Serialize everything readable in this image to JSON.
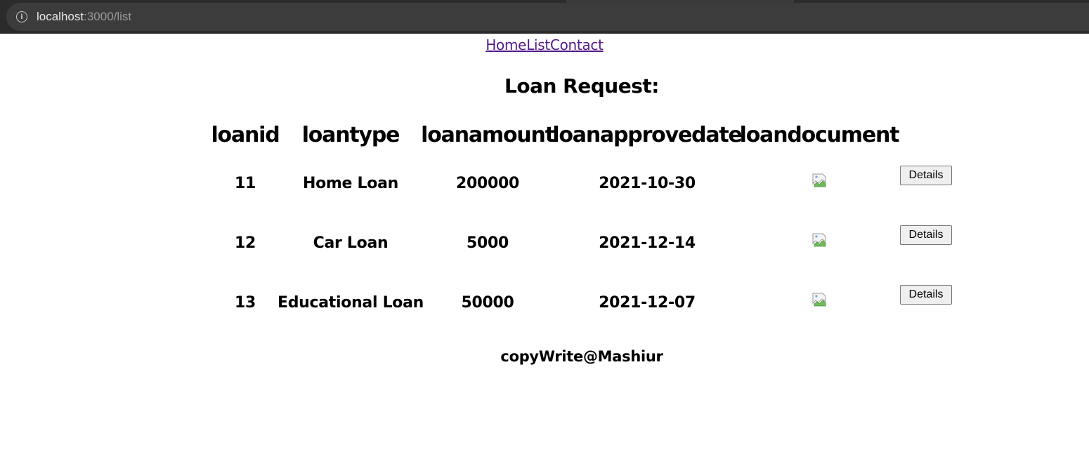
{
  "browser": {
    "url_host": "localhost",
    "url_path": ":3000/list"
  },
  "nav": {
    "home": "Home",
    "list": "List",
    "contact": "Contact"
  },
  "page_title": "Loan Request:",
  "table": {
    "headers": [
      "loanid",
      "loantype",
      "loanamount",
      "loanapprovedate",
      "loandocument"
    ],
    "rows": [
      {
        "loanid": "11",
        "loantype": "Home Loan",
        "loanamount": "200000",
        "loanapprovedate": "2021-10-30",
        "action": "Details"
      },
      {
        "loanid": "12",
        "loantype": "Car Loan",
        "loanamount": "5000",
        "loanapprovedate": "2021-12-14",
        "action": "Details"
      },
      {
        "loanid": "13",
        "loantype": "Educational Loan",
        "loanamount": "50000",
        "loanapprovedate": "2021-12-07",
        "action": "Details"
      }
    ]
  },
  "footer": "copyWrite@Mashiur",
  "icons": {
    "address_bar": "info-icon",
    "document": "broken-image-icon"
  }
}
